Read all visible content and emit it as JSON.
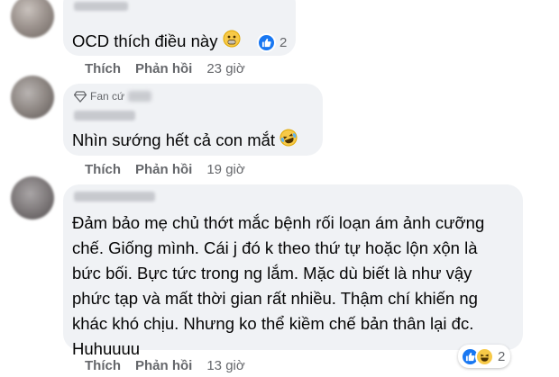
{
  "comments": [
    {
      "text_lines": [
        "OCD thích điều này"
      ],
      "reaction_count": "2",
      "reactions": [
        "like-icon"
      ],
      "emoji": "fearful-face-icon",
      "actions": {
        "like": "Thích",
        "reply": "Phản hồi",
        "time": "23 giờ"
      }
    },
    {
      "badge": "Fan cứ",
      "text_lines": [
        "Nhìn sướng hết cả con mắt"
      ],
      "emoji": "laughing-tears-icon",
      "actions": {
        "like": "Thích",
        "reply": "Phản hồi",
        "time": "19 giờ"
      }
    },
    {
      "text_lines": [
        "Đảm bảo mẹ chủ thớt mắc bệnh rối loạn ám ảnh cưỡng",
        "chế. Giống mình. Cái j đó k theo thứ tự hoặc lộn xộn là",
        "bức bối. Bực tức trong ng lắm. Mặc dù biết là như vậy",
        "phức tạp và mất thời gian rất nhiều. Thậm chí khiến ng",
        "khác khó chịu. Nhưng ko thể kiềm chế bản thân lại đc.",
        "Huhuuuu"
      ],
      "reaction_count": "2",
      "reactions": [
        "like-icon",
        "haha-icon"
      ],
      "actions": {
        "like": "Thích",
        "reply": "Phản hồi",
        "time": "13 giờ"
      }
    }
  ],
  "colors": {
    "bubble": "#f0f2f5",
    "meta": "#65676b",
    "like_blue": "#1877f2",
    "haha_yellow": "#f7c948"
  }
}
